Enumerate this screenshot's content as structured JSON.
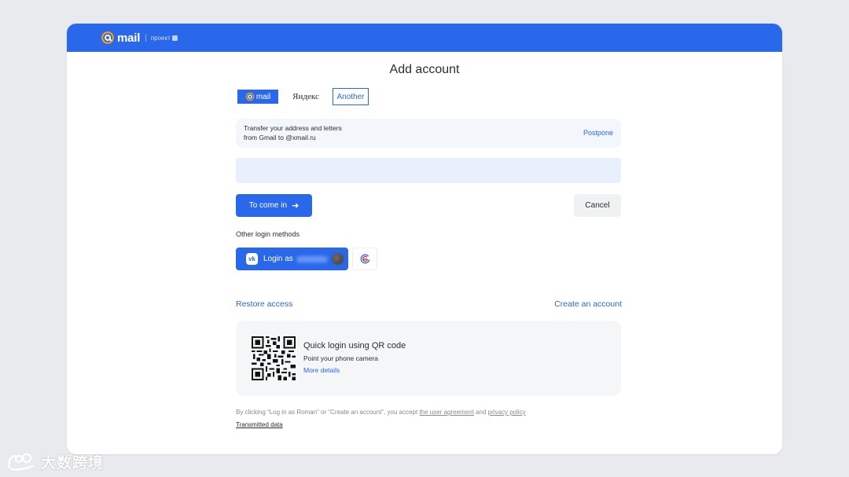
{
  "header": {
    "logo_text": "mail",
    "logo_sub": "проект"
  },
  "page": {
    "title": "Add account"
  },
  "providers": {
    "mail": "mail",
    "yandex": "Яндекс",
    "another": "Another"
  },
  "banner": {
    "text_line1": "Transfer your address and letters",
    "text_line2": "from Gmail to @xmail.ru",
    "postpone": "Postpone"
  },
  "login_form": {
    "input_value": "",
    "submit_label": "To come in",
    "submit_arrow": "➜",
    "cancel_label": "Cancel"
  },
  "other_methods": {
    "label": "Other login methods",
    "vk_icon": "vk",
    "vk_label": "Login as"
  },
  "links": {
    "restore": "Restore access",
    "create": "Create an account"
  },
  "qr": {
    "title": "Quick login using QR code",
    "subtitle": "Point your phone camera",
    "more": "More details"
  },
  "legal": {
    "prefix": "By clicking “Log in as Roman” or “Create an account”, you accept ",
    "agreement": "the user agreement",
    "and": " and ",
    "privacy": "privacy policy",
    "transmitted": "Transmitted data"
  },
  "watermark": {
    "text": "大数跨境"
  },
  "colors": {
    "accent": "#2a68eb",
    "logo_at": "#ff9e00",
    "page_bg": "#e9eaee",
    "input_bg": "#e8f0fe"
  }
}
